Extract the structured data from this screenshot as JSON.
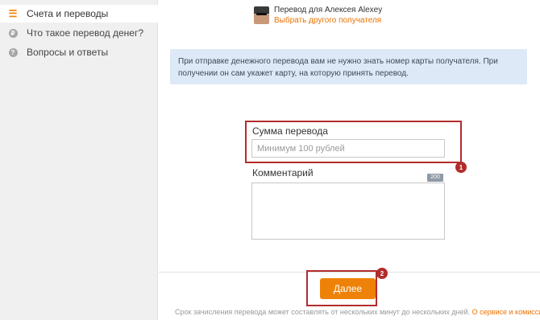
{
  "sidebar": {
    "items": [
      {
        "label": "Счета и переводы",
        "icon": "list-icon",
        "active": true
      },
      {
        "label": "Что такое перевод денег?",
        "icon": "info-icon",
        "active": false
      },
      {
        "label": "Вопросы и ответы",
        "icon": "help-icon",
        "active": false
      }
    ]
  },
  "recipient": {
    "title": "Перевод для Алексея Alexey",
    "change_link": "Выбрать другого получателя"
  },
  "notice": {
    "text": "При отправке денежного перевода вам не нужно знать номер карты получателя. При получении он сам укажет карту, на которую принять перевод."
  },
  "form": {
    "amount_label": "Сумма перевода",
    "amount_placeholder": "Минимум 100 рублей",
    "amount_value": "",
    "comment_label": "Комментарий",
    "comment_counter": "200",
    "comment_value": ""
  },
  "annotations": {
    "badge1": "1",
    "badge2": "2",
    "color": "#b22c2c"
  },
  "actions": {
    "next_label": "Далее",
    "accent": "#ee8208"
  },
  "footer": {
    "text": "Срок зачисления перевода может составлять от нескольких минут до нескольких дней.",
    "link": "О сервисе и комиссии"
  }
}
